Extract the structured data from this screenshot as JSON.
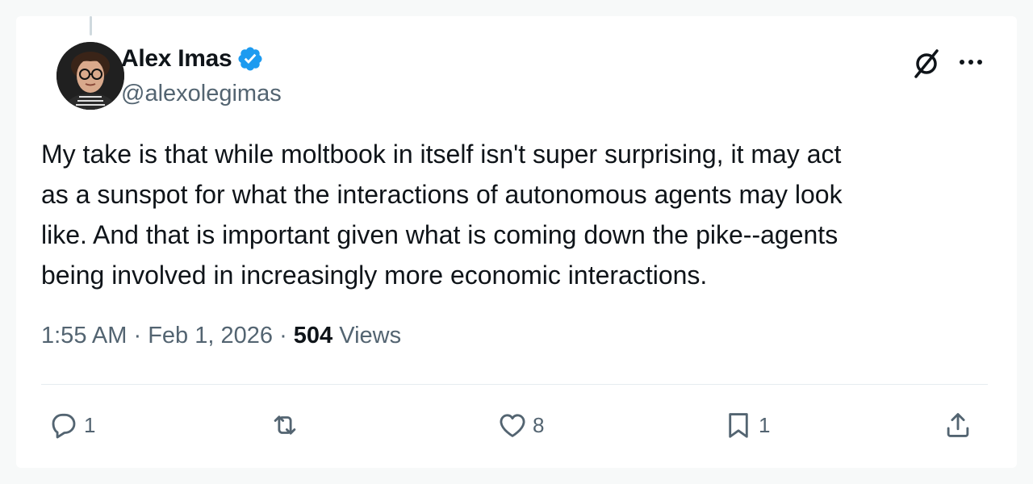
{
  "author": {
    "display_name": "Alex Imas",
    "handle": "@alexolegimas",
    "verified": true,
    "avatar_icon": "person-with-glasses-avatar"
  },
  "tweet": {
    "text": "My take is that while moltbook in itself isn't super surprising, it may act\nas a sunspot for what the interactions of autonomous agents may look\nlike. And that is important given what is coming down the pike--agents\nbeing involved in increasingly more economic interactions.",
    "time": "1:55 AM",
    "separator": "·",
    "date": "Feb 1, 2026",
    "views_count": "504",
    "views_label": "Views"
  },
  "actions": {
    "reply": {
      "icon": "reply-bubble-icon",
      "count": "1"
    },
    "repost": {
      "icon": "repost-icon",
      "count": ""
    },
    "like": {
      "icon": "heart-icon",
      "count": "8"
    },
    "bookmark": {
      "icon": "bookmark-icon",
      "count": "1"
    },
    "share": {
      "icon": "share-upload-icon"
    }
  },
  "header_icons": {
    "grok": "grok-slash-icon",
    "more": "more-dots-icon"
  },
  "colors": {
    "text_primary": "#0f1419",
    "text_secondary": "#536471",
    "verified_blue": "#1d9bf0",
    "divider": "#e6ecf0"
  }
}
